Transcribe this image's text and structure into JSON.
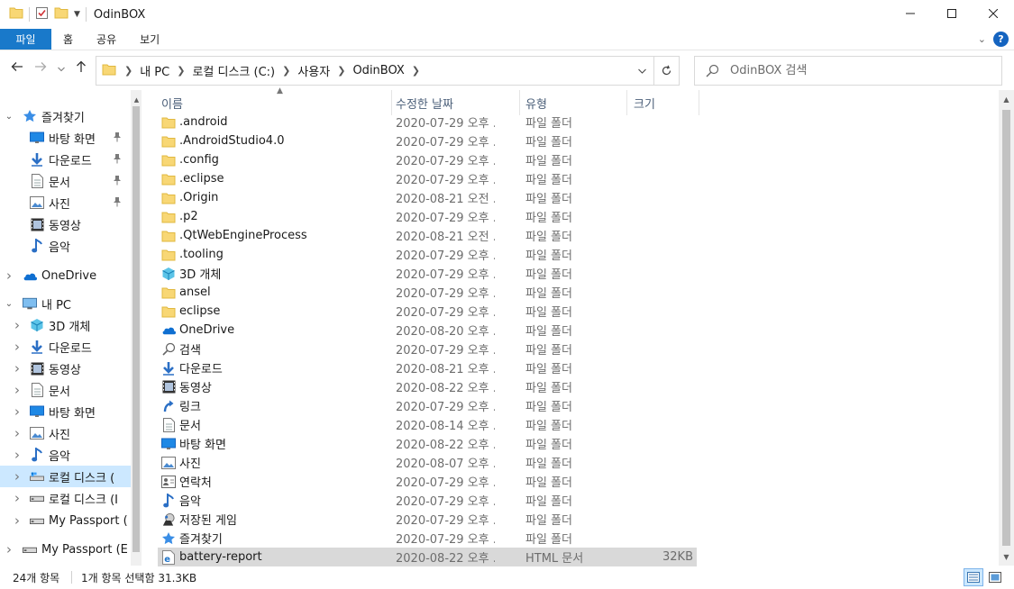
{
  "window": {
    "title": "OdinBOX",
    "controls": [
      "minimize",
      "maximize",
      "close"
    ]
  },
  "ribbon": {
    "tabs": [
      {
        "label": "파일",
        "active": true
      },
      {
        "label": "홈"
      },
      {
        "label": "공유"
      },
      {
        "label": "보기"
      }
    ],
    "help_label": "?"
  },
  "address": {
    "crumbs": [
      "내 PC",
      "로컬 디스크 (C:)",
      "사용자",
      "OdinBOX"
    ],
    "search_placeholder": "OdinBOX 검색"
  },
  "nav_pane": {
    "items": [
      {
        "label": "즐겨찾기",
        "icon": "star-icon",
        "chevron": "expanded",
        "level": 0
      },
      {
        "label": "바탕 화면",
        "icon": "desktop-icon",
        "pinned": true,
        "level": 1
      },
      {
        "label": "다운로드",
        "icon": "download-icon",
        "pinned": true,
        "level": 1
      },
      {
        "label": "문서",
        "icon": "document-icon",
        "pinned": true,
        "level": 1
      },
      {
        "label": "사진",
        "icon": "picture-icon",
        "pinned": true,
        "level": 1
      },
      {
        "label": "동영상",
        "icon": "video-icon",
        "level": 1
      },
      {
        "label": "음악",
        "icon": "music-icon",
        "level": 1
      },
      {
        "label": "OneDrive",
        "icon": "onedrive-icon",
        "chevron": "collapsed",
        "level": 0
      },
      {
        "label": "내 PC",
        "icon": "pc-icon",
        "chevron": "expanded",
        "level": 0
      },
      {
        "label": "3D 개체",
        "icon": "3d-objects-icon",
        "chevron": "collapsed",
        "level": 1
      },
      {
        "label": "다운로드",
        "icon": "download-icon",
        "chevron": "collapsed",
        "level": 1
      },
      {
        "label": "동영상",
        "icon": "video-icon",
        "chevron": "collapsed",
        "level": 1
      },
      {
        "label": "문서",
        "icon": "document-icon",
        "chevron": "collapsed",
        "level": 1
      },
      {
        "label": "바탕 화면",
        "icon": "desktop-icon",
        "chevron": "collapsed",
        "level": 1
      },
      {
        "label": "사진",
        "icon": "picture-icon",
        "chevron": "collapsed",
        "level": 1
      },
      {
        "label": "음악",
        "icon": "music-icon",
        "chevron": "collapsed",
        "level": 1
      },
      {
        "label": "로컬 디스크 (",
        "icon": "local-disk-icon",
        "chevron": "collapsed",
        "level": 1,
        "selected": true
      },
      {
        "label": "로컬 디스크 (I",
        "icon": "drive-icon",
        "chevron": "collapsed",
        "level": 1
      },
      {
        "label": "My Passport (",
        "icon": "drive-icon",
        "chevron": "collapsed",
        "level": 1
      },
      {
        "label": "My Passport (E",
        "icon": "drive-icon",
        "chevron": "collapsed",
        "level": 0
      }
    ]
  },
  "file_list": {
    "columns": {
      "name": "이름",
      "date": "수정한 날짜",
      "type": "유형",
      "size": "크기"
    },
    "rows": [
      {
        "name": ".android",
        "date": "2020-07-29 오후 ...",
        "type": "파일 폴더",
        "size": "",
        "icon": "folder-icon"
      },
      {
        "name": ".AndroidStudio4.0",
        "date": "2020-07-29 오후 ...",
        "type": "파일 폴더",
        "size": "",
        "icon": "folder-icon"
      },
      {
        "name": ".config",
        "date": "2020-07-29 오후 ...",
        "type": "파일 폴더",
        "size": "",
        "icon": "folder-icon"
      },
      {
        "name": ".eclipse",
        "date": "2020-07-29 오후 ...",
        "type": "파일 폴더",
        "size": "",
        "icon": "folder-icon"
      },
      {
        "name": ".Origin",
        "date": "2020-08-21 오전 ...",
        "type": "파일 폴더",
        "size": "",
        "icon": "folder-icon"
      },
      {
        "name": ".p2",
        "date": "2020-07-29 오후 ...",
        "type": "파일 폴더",
        "size": "",
        "icon": "folder-icon"
      },
      {
        "name": ".QtWebEngineProcess",
        "date": "2020-08-21 오전 ...",
        "type": "파일 폴더",
        "size": "",
        "icon": "folder-icon"
      },
      {
        "name": ".tooling",
        "date": "2020-07-29 오후 ...",
        "type": "파일 폴더",
        "size": "",
        "icon": "folder-icon"
      },
      {
        "name": "3D 개체",
        "date": "2020-07-29 오후 ...",
        "type": "파일 폴더",
        "size": "",
        "icon": "3d-objects-icon"
      },
      {
        "name": "ansel",
        "date": "2020-07-29 오후 ...",
        "type": "파일 폴더",
        "size": "",
        "icon": "folder-icon"
      },
      {
        "name": "eclipse",
        "date": "2020-07-29 오후 ...",
        "type": "파일 폴더",
        "size": "",
        "icon": "folder-icon"
      },
      {
        "name": "OneDrive",
        "date": "2020-08-20 오후 ...",
        "type": "파일 폴더",
        "size": "",
        "icon": "onedrive-icon"
      },
      {
        "name": "검색",
        "date": "2020-07-29 오후 ...",
        "type": "파일 폴더",
        "size": "",
        "icon": "search-icon"
      },
      {
        "name": "다운로드",
        "date": "2020-08-21 오후 ...",
        "type": "파일 폴더",
        "size": "",
        "icon": "download-icon"
      },
      {
        "name": "동영상",
        "date": "2020-08-22 오후 ...",
        "type": "파일 폴더",
        "size": "",
        "icon": "video-icon"
      },
      {
        "name": "링크",
        "date": "2020-07-29 오후 ...",
        "type": "파일 폴더",
        "size": "",
        "icon": "link-icon"
      },
      {
        "name": "문서",
        "date": "2020-08-14 오후 ...",
        "type": "파일 폴더",
        "size": "",
        "icon": "document-icon"
      },
      {
        "name": "바탕 화면",
        "date": "2020-08-22 오후 ...",
        "type": "파일 폴더",
        "size": "",
        "icon": "desktop-icon"
      },
      {
        "name": "사진",
        "date": "2020-08-07 오후 ...",
        "type": "파일 폴더",
        "size": "",
        "icon": "picture-icon"
      },
      {
        "name": "연락처",
        "date": "2020-07-29 오후 ...",
        "type": "파일 폴더",
        "size": "",
        "icon": "contacts-icon"
      },
      {
        "name": "음악",
        "date": "2020-07-29 오후 ...",
        "type": "파일 폴더",
        "size": "",
        "icon": "music-icon"
      },
      {
        "name": "저장된 게임",
        "date": "2020-07-29 오후 ...",
        "type": "파일 폴더",
        "size": "",
        "icon": "saved-games-icon"
      },
      {
        "name": "즐겨찾기",
        "date": "2020-07-29 오후 ...",
        "type": "파일 폴더",
        "size": "",
        "icon": "star-icon"
      },
      {
        "name": "battery-report",
        "date": "2020-08-22 오후 ...",
        "type": "HTML 문서",
        "size": "32KB",
        "icon": "html-file-icon",
        "selected": true
      }
    ]
  },
  "status_bar": {
    "item_count": "24개 항목",
    "selection": "1개 항목 선택함 31.3KB"
  },
  "view_modes": [
    "details",
    "large-icons"
  ],
  "colors": {
    "accent": "#1979ca",
    "folder": "#f8d775",
    "selected_nav": "#cce8ff",
    "selected_row": "#d9d9d9"
  }
}
